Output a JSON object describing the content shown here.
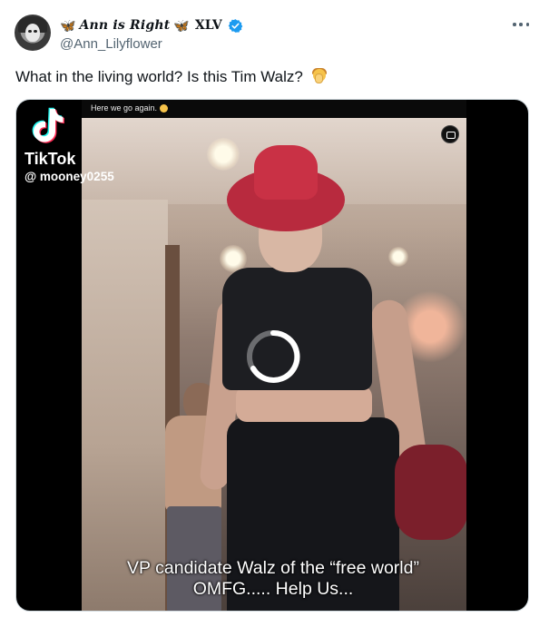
{
  "author": {
    "display_name": "Ann is Right",
    "name_suffix": "XLV",
    "handle": "@Ann_Lilyflower",
    "verified": true,
    "decor_icon": "dragonfly-emoji-icon",
    "verified_color": "#1d9bf0"
  },
  "tweet": {
    "text": "What in the living world? Is this Tim Walz?",
    "emoji": "woman-facepalming-emoji"
  },
  "media": {
    "top_caption": "Here we go again.",
    "watermark_brand": "TikTok",
    "watermark_user": "@ mooney0255",
    "subtitle_line1": "VP candidate Walz of the “free world”",
    "subtitle_line2": "OMFG..... Help Us...",
    "state": "loading"
  },
  "colors": {
    "text_primary": "#0f1419",
    "text_secondary": "#536471",
    "accent": "#1d9bf0"
  }
}
